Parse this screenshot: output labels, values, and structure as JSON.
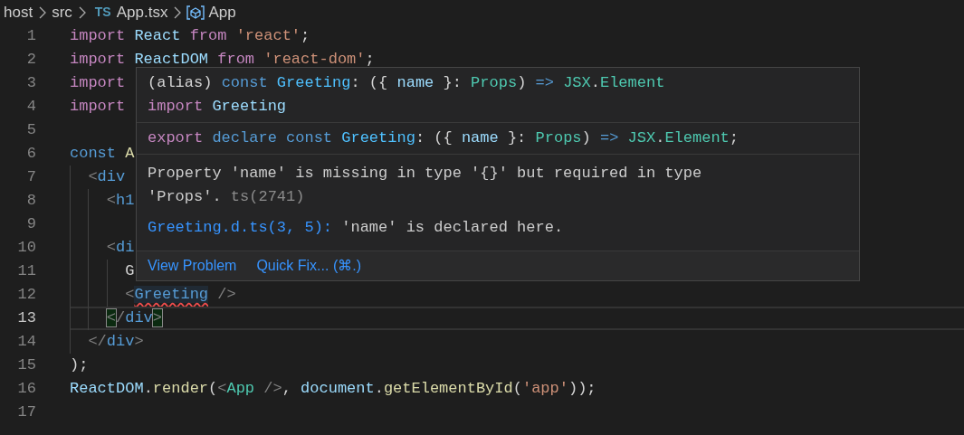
{
  "breadcrumb": [
    {
      "kind": "folder",
      "label": "host"
    },
    {
      "kind": "folder",
      "label": "src"
    },
    {
      "kind": "file",
      "badge": "TS",
      "label": "App.tsx"
    },
    {
      "kind": "symbol",
      "label": "App"
    }
  ],
  "lines": [
    {
      "number": "1",
      "current": false,
      "tokens": [
        {
          "text": "import ",
          "kind": "kw"
        },
        {
          "text": "React",
          "kind": "var"
        },
        {
          "text": " from ",
          "kind": "kw"
        },
        {
          "text": "'react'",
          "kind": "str"
        },
        {
          "text": ";",
          "kind": "plain"
        }
      ]
    },
    {
      "number": "2",
      "current": false,
      "tokens": [
        {
          "text": "import ",
          "kind": "kw"
        },
        {
          "text": "ReactDOM",
          "kind": "var"
        },
        {
          "text": " from ",
          "kind": "kw"
        },
        {
          "text": "'react-dom'",
          "kind": "str"
        },
        {
          "text": ";",
          "kind": "plain"
        }
      ]
    },
    {
      "number": "3",
      "current": false,
      "tokens": [
        {
          "text": "import",
          "kind": "kw"
        }
      ]
    },
    {
      "number": "4",
      "current": false,
      "tokens": [
        {
          "text": "import",
          "kind": "kw"
        }
      ]
    },
    {
      "number": "5",
      "current": false
    },
    {
      "number": "6",
      "current": false,
      "tokens": [
        {
          "text": "const ",
          "kind": "storage"
        },
        {
          "text": "A",
          "kind": "fn"
        }
      ]
    },
    {
      "number": "7",
      "current": false,
      "tokens": [
        {
          "text": "  <",
          "kind": "punct"
        },
        {
          "text": "div",
          "kind": "storage"
        }
      ]
    },
    {
      "number": "8",
      "current": false,
      "tokens": [
        {
          "text": "    <",
          "kind": "punct"
        },
        {
          "text": "h1",
          "kind": "storage"
        }
      ]
    },
    {
      "number": "9",
      "current": false
    },
    {
      "number": "10",
      "current": false,
      "tokens": [
        {
          "text": "    <",
          "kind": "punct"
        },
        {
          "text": "di",
          "kind": "storage"
        }
      ]
    },
    {
      "number": "11",
      "current": false,
      "tokens": [
        {
          "text": "      G",
          "kind": "plain"
        }
      ]
    },
    {
      "number": "12",
      "current": false,
      "tokens": [
        {
          "text": "      <",
          "kind": "punct"
        },
        {
          "text": "Greeting",
          "kind": "storage",
          "error": true
        },
        {
          "text": " />",
          "kind": "punct"
        }
      ]
    },
    {
      "number": "13",
      "current": true,
      "tokens": [
        {
          "text": "    <",
          "kind": "punct",
          "match": true
        },
        {
          "text": "/",
          "kind": "punct"
        },
        {
          "text": "div",
          "kind": "storage"
        },
        {
          "text": ">",
          "kind": "punct",
          "match": true
        }
      ]
    },
    {
      "number": "14",
      "current": false,
      "tokens": [
        {
          "text": "  </",
          "kind": "punct"
        },
        {
          "text": "div",
          "kind": "storage"
        },
        {
          "text": ">",
          "kind": "punct"
        }
      ]
    },
    {
      "number": "15",
      "current": false,
      "tokens": [
        {
          "text": ");",
          "kind": "plain"
        }
      ]
    },
    {
      "number": "16",
      "current": false,
      "tokens": [
        {
          "text": "ReactDOM",
          "kind": "var"
        },
        {
          "text": ".",
          "kind": "plain"
        },
        {
          "text": "render",
          "kind": "fn"
        },
        {
          "text": "(",
          "kind": "plain"
        },
        {
          "text": "<",
          "kind": "punct"
        },
        {
          "text": "App",
          "kind": "type"
        },
        {
          "text": " />",
          "kind": "punct"
        },
        {
          "text": ", ",
          "kind": "plain"
        },
        {
          "text": "document",
          "kind": "var"
        },
        {
          "text": ".",
          "kind": "plain"
        },
        {
          "text": "getElementById",
          "kind": "fn"
        },
        {
          "text": "(",
          "kind": "plain"
        },
        {
          "text": "'app'",
          "kind": "str"
        },
        {
          "text": "));",
          "kind": "plain"
        }
      ]
    },
    {
      "number": "17",
      "current": false
    }
  ],
  "hover": {
    "signature": [
      [
        {
          "text": "(alias) ",
          "kind": "plain"
        },
        {
          "text": "const ",
          "kind": "storage"
        },
        {
          "text": "Greeting",
          "kind": "const"
        },
        {
          "text": ": ({ ",
          "kind": "plain"
        },
        {
          "text": "name",
          "kind": "var"
        },
        {
          "text": " }: ",
          "kind": "plain"
        },
        {
          "text": "Props",
          "kind": "type"
        },
        {
          "text": ") ",
          "kind": "plain"
        },
        {
          "text": "=>",
          "kind": "storage"
        },
        {
          "text": " JSX",
          "kind": "type"
        },
        {
          "text": ".",
          "kind": "plain"
        },
        {
          "text": "Element",
          "kind": "type"
        }
      ],
      [
        {
          "text": "import ",
          "kind": "kw"
        },
        {
          "text": "Greeting",
          "kind": "var"
        }
      ]
    ],
    "declaration": [
      {
        "text": "export ",
        "kind": "kw"
      },
      {
        "text": "declare ",
        "kind": "storage"
      },
      {
        "text": "const ",
        "kind": "storage"
      },
      {
        "text": "Greeting",
        "kind": "const"
      },
      {
        "text": ": ({ ",
        "kind": "plain"
      },
      {
        "text": "name",
        "kind": "var"
      },
      {
        "text": " }: ",
        "kind": "plain"
      },
      {
        "text": "Props",
        "kind": "type"
      },
      {
        "text": ") ",
        "kind": "plain"
      },
      {
        "text": "=>",
        "kind": "storage"
      },
      {
        "text": " JSX",
        "kind": "type"
      },
      {
        "text": ".",
        "kind": "plain"
      },
      {
        "text": "Element",
        "kind": "type"
      },
      {
        "text": ";",
        "kind": "plain"
      }
    ],
    "message": "Property 'name' is missing in type '{}' but required in type 'Props'.",
    "code": "ts(2741)",
    "related_link": "Greeting.d.ts(3, 5):",
    "related_text": "'name' is declared here.",
    "actions": [
      "View Problem",
      "Quick Fix... (⌘.)"
    ]
  }
}
